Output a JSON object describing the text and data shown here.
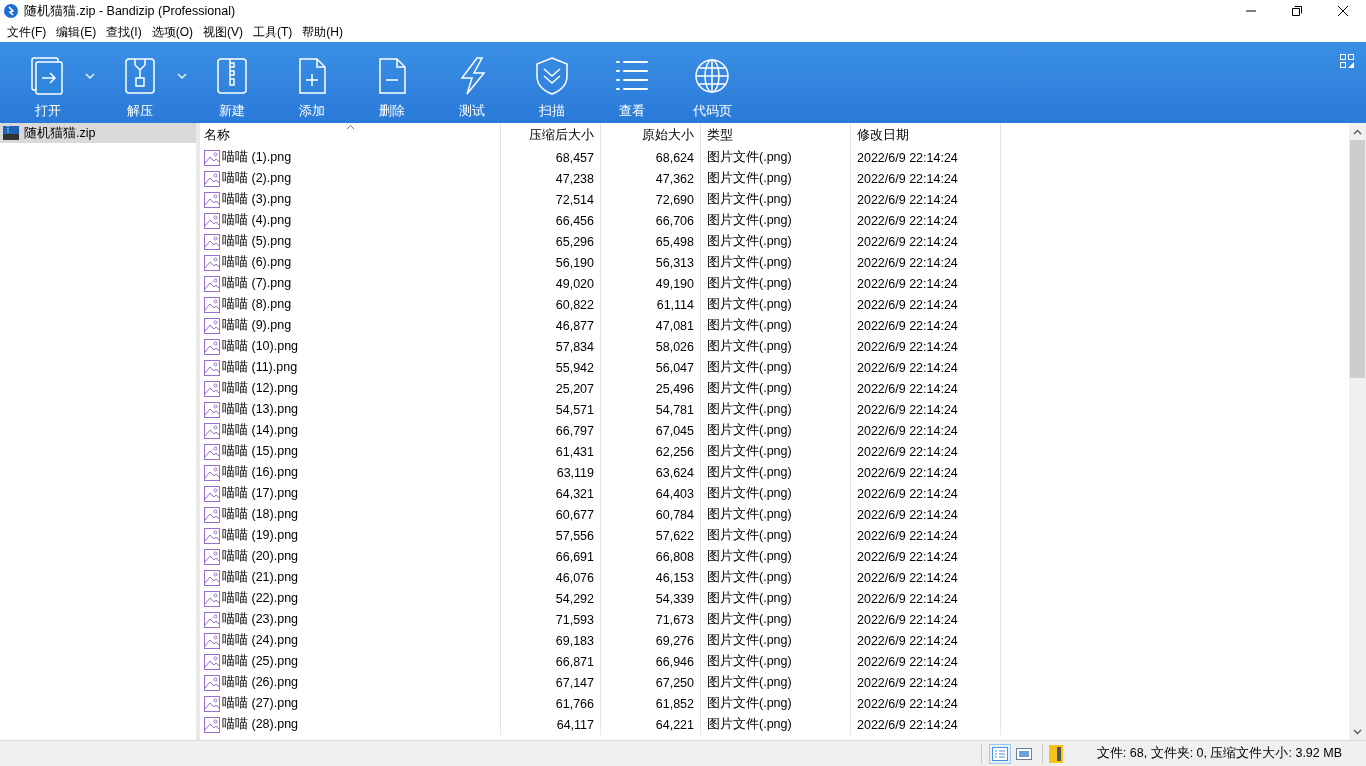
{
  "window": {
    "title": "随机猫猫.zip - Bandizip (Professional)"
  },
  "menu": [
    "文件(F)",
    "编辑(E)",
    "查找(I)",
    "选项(O)",
    "视图(V)",
    "工具(T)",
    "帮助(H)"
  ],
  "toolbar": [
    {
      "label": "打开",
      "has_menu": true
    },
    {
      "label": "解压",
      "has_menu": true
    },
    {
      "label": "新建",
      "has_menu": false
    },
    {
      "label": "添加",
      "has_menu": false
    },
    {
      "label": "删除",
      "has_menu": false
    },
    {
      "label": "测试",
      "has_menu": false
    },
    {
      "label": "扫描",
      "has_menu": false
    },
    {
      "label": "查看",
      "has_menu": false
    },
    {
      "label": "代码页",
      "has_menu": false
    }
  ],
  "tree": {
    "items": [
      {
        "label": "随机猫猫.zip",
        "selected": true
      }
    ]
  },
  "table": {
    "columns": [
      {
        "label": "名称",
        "sorted": true
      },
      {
        "label": "压缩后大小",
        "sorted": false
      },
      {
        "label": "原始大小",
        "sorted": false
      },
      {
        "label": "类型",
        "sorted": false
      },
      {
        "label": "修改日期",
        "sorted": false
      }
    ],
    "rows": [
      [
        "喵喵 (1).png",
        "68,457",
        "68,624",
        "图片文件(.png)",
        "2022/6/9 22:14:24"
      ],
      [
        "喵喵 (2).png",
        "47,238",
        "47,362",
        "图片文件(.png)",
        "2022/6/9 22:14:24"
      ],
      [
        "喵喵 (3).png",
        "72,514",
        "72,690",
        "图片文件(.png)",
        "2022/6/9 22:14:24"
      ],
      [
        "喵喵 (4).png",
        "66,456",
        "66,706",
        "图片文件(.png)",
        "2022/6/9 22:14:24"
      ],
      [
        "喵喵 (5).png",
        "65,296",
        "65,498",
        "图片文件(.png)",
        "2022/6/9 22:14:24"
      ],
      [
        "喵喵 (6).png",
        "56,190",
        "56,313",
        "图片文件(.png)",
        "2022/6/9 22:14:24"
      ],
      [
        "喵喵 (7).png",
        "49,020",
        "49,190",
        "图片文件(.png)",
        "2022/6/9 22:14:24"
      ],
      [
        "喵喵 (8).png",
        "60,822",
        "61,114",
        "图片文件(.png)",
        "2022/6/9 22:14:24"
      ],
      [
        "喵喵 (9).png",
        "46,877",
        "47,081",
        "图片文件(.png)",
        "2022/6/9 22:14:24"
      ],
      [
        "喵喵 (10).png",
        "57,834",
        "58,026",
        "图片文件(.png)",
        "2022/6/9 22:14:24"
      ],
      [
        "喵喵 (11).png",
        "55,942",
        "56,047",
        "图片文件(.png)",
        "2022/6/9 22:14:24"
      ],
      [
        "喵喵 (12).png",
        "25,207",
        "25,496",
        "图片文件(.png)",
        "2022/6/9 22:14:24"
      ],
      [
        "喵喵 (13).png",
        "54,571",
        "54,781",
        "图片文件(.png)",
        "2022/6/9 22:14:24"
      ],
      [
        "喵喵 (14).png",
        "66,797",
        "67,045",
        "图片文件(.png)",
        "2022/6/9 22:14:24"
      ],
      [
        "喵喵 (15).png",
        "61,431",
        "62,256",
        "图片文件(.png)",
        "2022/6/9 22:14:24"
      ],
      [
        "喵喵 (16).png",
        "63,119",
        "63,624",
        "图片文件(.png)",
        "2022/6/9 22:14:24"
      ],
      [
        "喵喵 (17).png",
        "64,321",
        "64,403",
        "图片文件(.png)",
        "2022/6/9 22:14:24"
      ],
      [
        "喵喵 (18).png",
        "60,677",
        "60,784",
        "图片文件(.png)",
        "2022/6/9 22:14:24"
      ],
      [
        "喵喵 (19).png",
        "57,556",
        "57,622",
        "图片文件(.png)",
        "2022/6/9 22:14:24"
      ],
      [
        "喵喵 (20).png",
        "66,691",
        "66,808",
        "图片文件(.png)",
        "2022/6/9 22:14:24"
      ],
      [
        "喵喵 (21).png",
        "46,076",
        "46,153",
        "图片文件(.png)",
        "2022/6/9 22:14:24"
      ],
      [
        "喵喵 (22).png",
        "54,292",
        "54,339",
        "图片文件(.png)",
        "2022/6/9 22:14:24"
      ],
      [
        "喵喵 (23).png",
        "71,593",
        "71,673",
        "图片文件(.png)",
        "2022/6/9 22:14:24"
      ],
      [
        "喵喵 (24).png",
        "69,183",
        "69,276",
        "图片文件(.png)",
        "2022/6/9 22:14:24"
      ],
      [
        "喵喵 (25).png",
        "66,871",
        "66,946",
        "图片文件(.png)",
        "2022/6/9 22:14:24"
      ],
      [
        "喵喵 (26).png",
        "67,147",
        "67,250",
        "图片文件(.png)",
        "2022/6/9 22:14:24"
      ],
      [
        "喵喵 (27).png",
        "61,766",
        "61,852",
        "图片文件(.png)",
        "2022/6/9 22:14:24"
      ],
      [
        "喵喵 (28).png",
        "64,117",
        "64,221",
        "图片文件(.png)",
        "2022/6/9 22:14:24"
      ]
    ]
  },
  "status_bar": {
    "views": [
      {
        "selected": true
      },
      {
        "selected": false
      }
    ],
    "text": "文件: 68, 文件夹: 0, 压缩文件大小: 3.92 MB"
  }
}
